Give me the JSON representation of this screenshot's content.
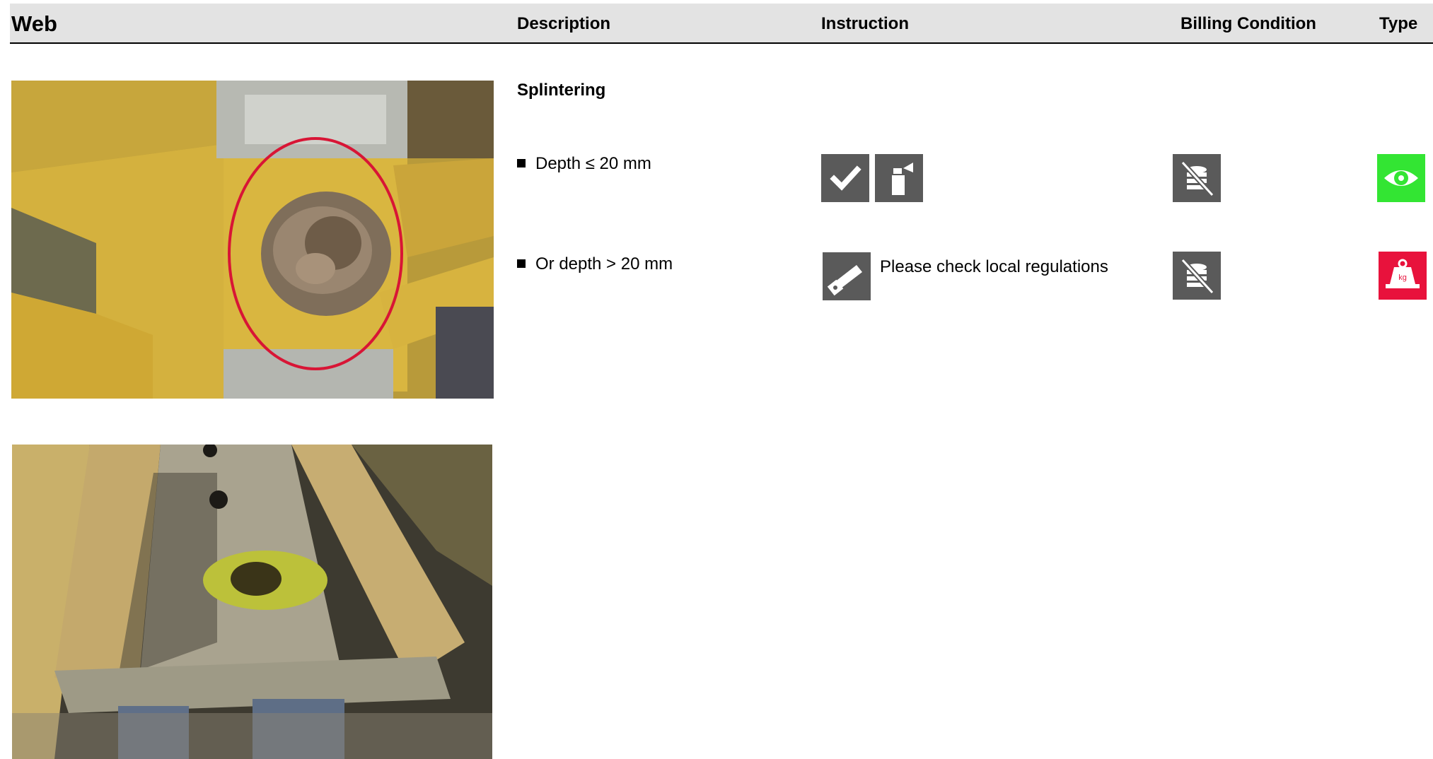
{
  "header": {
    "web": "Web",
    "description": "Description",
    "instruction": "Instruction",
    "billing_condition": "Billing Condition",
    "type": "Type"
  },
  "section": {
    "title": "Splintering",
    "rows": [
      {
        "description": "Depth ≤ 20 mm",
        "instruction_icons": [
          "checkmark-icon",
          "spray-can-icon"
        ],
        "instruction_text": "",
        "billing_icon": "no-charge-coins-icon",
        "type_icon": "eye-icon",
        "type_color": "#33e533"
      },
      {
        "description": "Or depth > 20 mm",
        "instruction_icons": [
          "saw-icon"
        ],
        "instruction_text": "Please check local regulations",
        "billing_icon": "no-charge-coins-icon",
        "type_icon": "weight-kg-icon",
        "type_color": "#e8123c"
      }
    ]
  },
  "colors": {
    "icon_gray": "#5a5a5a",
    "header_bg": "#e3e3e3"
  }
}
